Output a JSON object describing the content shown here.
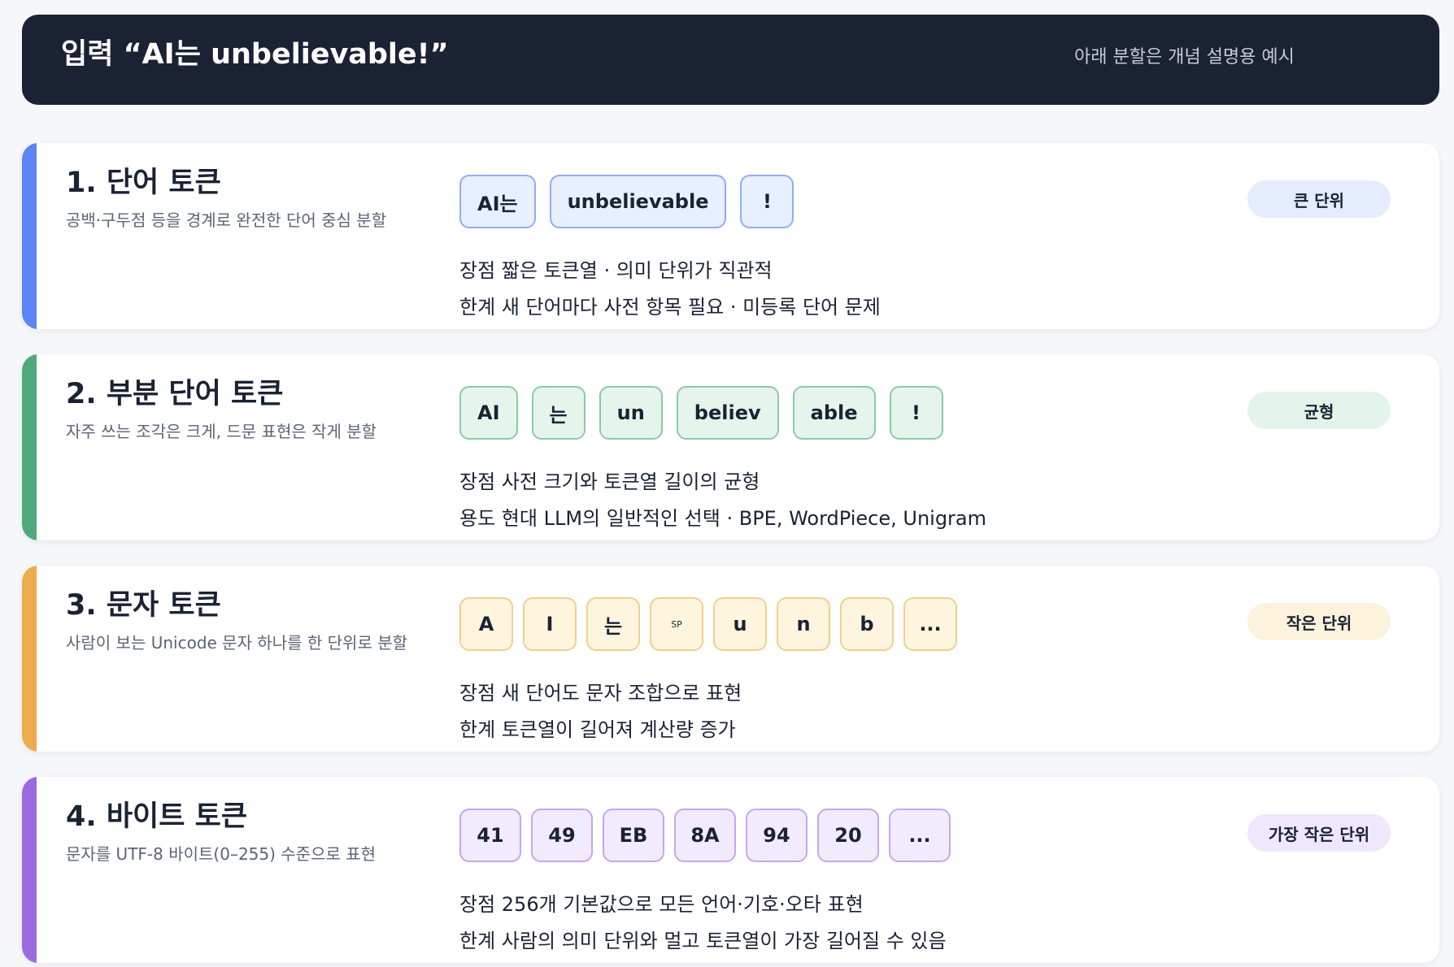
{
  "header": {
    "title": "입력 “AI는 unbelievable!”",
    "note": "아래 분할은 개념 설명용 예시"
  },
  "cards": [
    {
      "title": "1. 단어 토큰",
      "desc": "공백·구두점 등을 경계로 완전한 단어 중심 분할",
      "badge": "큰 단위",
      "tokens": [
        "AI는",
        "unbelievable",
        "!"
      ],
      "line1": "장점 짧은 토큰열 · 의미 단위가 직관적",
      "line2": "한계 새 단어마다 사전 항목 필요 · 미등록 단어 문제",
      "colors": {
        "accent": "#5b85f5",
        "token_bg": "#e8efff",
        "token_border": "#8fadf6",
        "badge_bg": "#e4ecfd"
      }
    },
    {
      "title": "2. 부분 단어 토큰",
      "desc": "자주 쓰는 조각은 크게, 드문 표현은 작게 분할",
      "badge": "균형",
      "tokens": [
        "AI",
        "는",
        "un",
        "believ",
        "able",
        "!"
      ],
      "line1": "장점 사전 크기와 토큰열 길이의 균형",
      "line2": "용도 현대 LLM의 일반적인 선택 · BPE, WordPiece, Unigram",
      "colors": {
        "accent": "#4fa97b",
        "token_bg": "#e5f5ec",
        "token_border": "#8ccaa6",
        "badge_bg": "#e3f4ea"
      }
    },
    {
      "title": "3. 문자 토큰",
      "desc": "사람이 보는 Unicode 문자 하나를 한 단위로 분할",
      "badge": "작은 단위",
      "tokens": [
        "A",
        "I",
        "는",
        "SP",
        "u",
        "n",
        "b",
        "..."
      ],
      "line1": "장점 새 단어도 문자 조합으로 표현",
      "line2": "한계 토큰열이 길어져 계산량 증가",
      "colors": {
        "accent": "#ecab4c",
        "token_bg": "#fff5df",
        "token_border": "#f2cf8c",
        "badge_bg": "#fdf3dc"
      }
    },
    {
      "title": "4. 바이트 토큰",
      "desc": "문자를 UTF-8 바이트(0–255) 수준으로 표현",
      "badge": "가장 작은 단위",
      "tokens": [
        "41",
        "49",
        "EB",
        "8A",
        "94",
        "20",
        "..."
      ],
      "line1": "장점 256개 기본값으로 모든 언어·기호·오타 표현",
      "line2": "한계 사람의 의미 단위와 멀고 토큰열이 가장 길어질 수 있음",
      "colors": {
        "accent": "#9c6be0",
        "token_bg": "#f2eafd",
        "token_border": "#c6a7f0",
        "badge_bg": "#efe7fb"
      }
    }
  ]
}
